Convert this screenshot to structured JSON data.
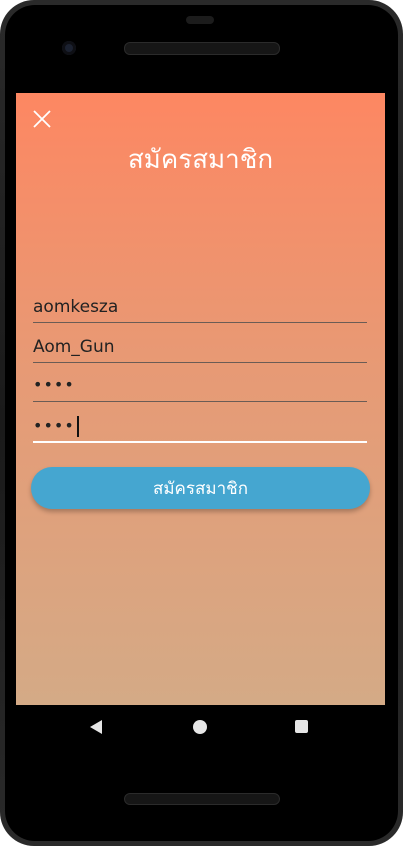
{
  "header": {
    "title": "สมัครสมาชิก",
    "close_icon": "close-icon"
  },
  "form": {
    "username_value": "aomkesza",
    "name_value": "Aom_Gun",
    "password_mask": "••••",
    "confirm_password_mask": "••••",
    "submit_label": "สมัครสมาชิก"
  },
  "navigation": {
    "back_icon": "back-triangle-icon",
    "home_icon": "home-circle-icon",
    "recent_icon": "recents-square-icon"
  },
  "colors": {
    "gradient_top": "#fd8762",
    "gradient_bottom": "#d4aa86",
    "button": "#45a6d0"
  }
}
